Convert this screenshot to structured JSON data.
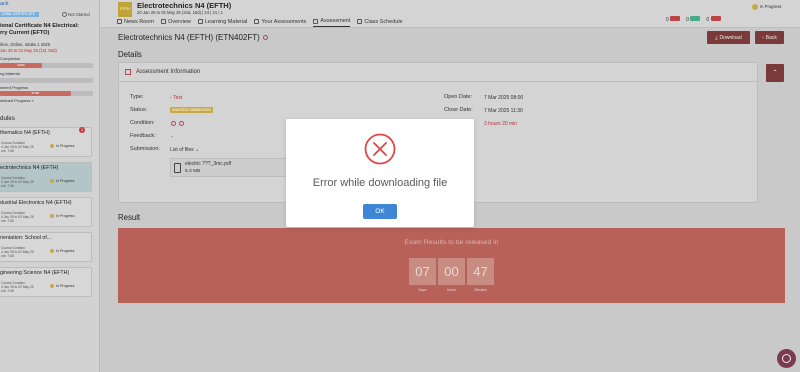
{
  "sidebar": {
    "back_label": "ack",
    "badge": "IONAL CERTIFICATE",
    "status": "Not Started",
    "title": "ional Certificate N4 Electrical:\nrry Current (EFTO)",
    "meta": "rline, Online, Intake 1 2025",
    "dates": "Jan 25 to 02 May 25 (1st, 55d)",
    "progress": [
      {
        "label": "Completion",
        "value": "30/80",
        "fill": 0.45,
        "color": "#c86a5f"
      },
      {
        "label": "ng Material",
        "value": "",
        "fill": 0.0,
        "color": "#c86a5f"
      },
      {
        "label": "sment Progress",
        "value": "87/98",
        "fill": 0.76,
        "color": "#c86a5f"
      }
    ],
    "link": "mbined Progress »",
    "modules_heading": "dules",
    "modules": [
      {
        "name": "thematics N4 (EFTH)",
        "sub": "Course Duration",
        "dates": "4 Jan 25 to 02 May 25",
        "id": "cnt: 7/48",
        "status": "In Progress",
        "notif": "1"
      },
      {
        "name": "ectrotechnics N4 (EFTH)",
        "sub": "Course Duration",
        "dates": "4 Jan 25 to 02 May 25",
        "id": "cnt: 7/48",
        "status": "In Progress",
        "notif": ""
      },
      {
        "name": "dustrial Electronics N4 (EFTH)",
        "sub": "Course Duration",
        "dates": "4 Jan 25 to 02 May 25",
        "id": "cnt: 7/48",
        "status": "In Progress",
        "notif": ""
      },
      {
        "name": "rientation: School of...",
        "sub": "Course Duration",
        "dates": "4 Jan 25 to 02 May 25",
        "id": "cnt: 7/48",
        "status": "In Progress",
        "notif": ""
      },
      {
        "name": "gineering Science N4 (EFTH)",
        "sub": "Course Duration",
        "dates": "4 Jan 25 to 02 May 25",
        "id": "cnt: 7/48",
        "status": "In Progress",
        "notif": ""
      }
    ]
  },
  "topbar": {
    "course_icon": "EFTH",
    "course_title": "Electrotechnics N4 (EFTH)",
    "course_sub": "20 Jan 25 to 02 May 25 (2nd, 15d) | 24 | 21 | 1",
    "tabs": [
      "News Room",
      "Overview",
      "Learning Material",
      "Your Assessments",
      "Assessment",
      "Class Schedule"
    ],
    "active_tab": 4,
    "right_counts": [
      "0",
      "0",
      "0"
    ],
    "progress_status": "In Progress"
  },
  "main": {
    "heading": "Electrotechnics N4 (EFTH) (ETN402FT)",
    "download_label": "Download",
    "back_label": "Back",
    "details_heading": "Details",
    "card_title": "Assessment Information",
    "labels": {
      "type": "Type:",
      "status": "Status:",
      "condition": "Condition:",
      "feedback": "Feedback:",
      "submission": "Submission:",
      "open_date": "Open Date:",
      "close_date": "Close Date:"
    },
    "values": {
      "type": "Test",
      "status": "AWAITING SUBMISSION",
      "feedback": "-",
      "submission": "List of files",
      "open_date": "7 Mar 2025 08:00",
      "close_date": "7 Mar 2025 11:30",
      "remaining": "3 hours 20 min"
    },
    "file": {
      "name": "electric ???_3mc.pdf",
      "size": "6.3 MB"
    },
    "result_heading": "Result",
    "result_text": "Exam Results to be released in",
    "countdown": [
      {
        "value": "07",
        "label": "Days"
      },
      {
        "value": "00",
        "label": "Hours"
      },
      {
        "value": "47",
        "label": "Minutes"
      }
    ]
  },
  "modal": {
    "message": "Error while downloading file",
    "ok_label": "OK",
    "icon_color": "#e04646",
    "button_color": "#3f86d6"
  }
}
